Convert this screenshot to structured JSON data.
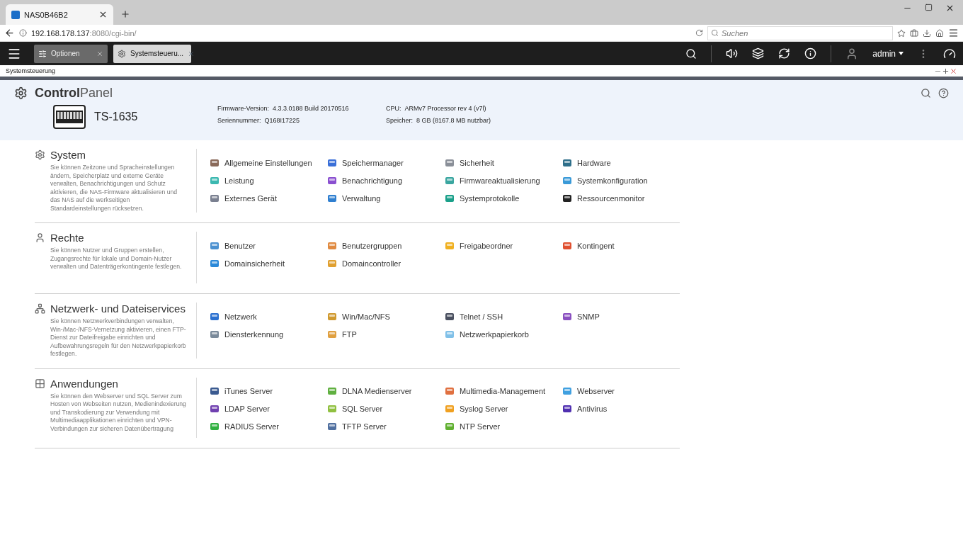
{
  "browser": {
    "tab": {
      "title": "NAS0B46B2"
    },
    "url": {
      "host": "192.168.178.137",
      "rest": ":8080/cgi-bin/"
    },
    "search": {
      "placeholder": "Suchen"
    }
  },
  "qts_bar": {
    "tabs": [
      {
        "label": "Optionen",
        "selected": false
      },
      {
        "label": "Systemsteueru...",
        "selected": true
      }
    ],
    "user": "admin"
  },
  "window": {
    "title": "Systemsteuerung"
  },
  "header": {
    "title_bold": "Control",
    "title_light": "Panel",
    "model": "TS-1635",
    "info": [
      {
        "label": "Firmware-Version:",
        "value": "4.3.3.0188 Build 20170516"
      },
      {
        "label": "Seriennummer:",
        "value": "Q168I17225"
      },
      {
        "label": "CPU:",
        "value": "ARMv7 Processor rev 4 (v7l)"
      },
      {
        "label": "Speicher:",
        "value": "8 GB (8167.8 MB nutzbar)"
      }
    ]
  },
  "sections": [
    {
      "title": "System",
      "description": "Sie können Zeitzone und Spracheinstellungen ändern, Speicherplatz und externe Geräte verwalten, Benachrichtigungen und Schutz aktivieren, die NAS-Firmware aktualisieren und das NAS auf die werkseitigen Standardeinstellungen rücksetzen.",
      "items": [
        {
          "label": "Allgemeine Einstellungen",
          "color": "#8a6a5a"
        },
        {
          "label": "Speichermanager",
          "color": "#3a6fd8"
        },
        {
          "label": "Sicherheit",
          "color": "#8a8f98"
        },
        {
          "label": "Hardware",
          "color": "#2f6f8a"
        },
        {
          "label": "Leistung",
          "color": "#3bb8b0"
        },
        {
          "label": "Benachrichtigung",
          "color": "#8a4fd0"
        },
        {
          "label": "Firmwareaktualisierung",
          "color": "#3aa6a0"
        },
        {
          "label": "Systemkonfiguration",
          "color": "#3a9ad8"
        },
        {
          "label": "Externes Gerät",
          "color": "#7a8090"
        },
        {
          "label": "Verwaltung",
          "color": "#2f7fd0"
        },
        {
          "label": "Systemprotokolle",
          "color": "#1aa08a"
        },
        {
          "label": "Ressourcenmonitor",
          "color": "#222222"
        }
      ]
    },
    {
      "title": "Rechte",
      "description": "Sie können Nutzer und Gruppen erstellen, Zugangsrechte für lokale und Domain-Nutzer verwalten und Datenträgerkontingente festlegen.",
      "items": [
        {
          "label": "Benutzer",
          "color": "#4a90d0"
        },
        {
          "label": "Benutzergruppen",
          "color": "#e08a40"
        },
        {
          "label": "Freigabeordner",
          "color": "#f0b020"
        },
        {
          "label": "Kontingent",
          "color": "#e05030"
        },
        {
          "label": "Domainsicherheit",
          "color": "#2a88d8"
        },
        {
          "label": "Domaincontroller",
          "color": "#e0a030"
        }
      ]
    },
    {
      "title": "Netzwerk- und Dateiservices",
      "description": "Sie können Netzwerkverbindungen verwalten, Win-/Mac-/NFS-Vernetzung aktivieren, einen FTP-Dienst zur Dateifreigabe einrichten und Aufbewahrungsregeln für den Netzwerkpapierkorb festlegen.",
      "items": [
        {
          "label": "Netzwerk",
          "color": "#2a70d0"
        },
        {
          "label": "Win/Mac/NFS",
          "color": "#d09a30"
        },
        {
          "label": "Telnet / SSH",
          "color": "#4a5060"
        },
        {
          "label": "SNMP",
          "color": "#8a50c0"
        },
        {
          "label": "Diensterkennung",
          "color": "#7a8a9a"
        },
        {
          "label": "FTP",
          "color": "#e0a040"
        },
        {
          "label": "Netzwerkpapierkorb",
          "color": "#80c0e8"
        }
      ]
    },
    {
      "title": "Anwendungen",
      "description": "Sie können den Webserver und SQL Server zum Hosten von Webseiten nutzen, Medienindexierung und Transkodierung zur Verwendung mit Multimediaapplikationen einrichten und VPN-Verbindungen zur sicheren Datenübertragung",
      "items": [
        {
          "label": "iTunes Server",
          "color": "#3a5a90"
        },
        {
          "label": "DLNA Medienserver",
          "color": "#60b040"
        },
        {
          "label": "Multimedia-Management",
          "color": "#e07040"
        },
        {
          "label": "Webserver",
          "color": "#40a0e0"
        },
        {
          "label": "LDAP Server",
          "color": "#7040b0"
        },
        {
          "label": "SQL Server",
          "color": "#90c040"
        },
        {
          "label": "Syslog Server",
          "color": "#f0a020"
        },
        {
          "label": "Antivirus",
          "color": "#5030b0"
        },
        {
          "label": "RADIUS Server",
          "color": "#30b040"
        },
        {
          "label": "TFTP Server",
          "color": "#5070a0"
        },
        {
          "label": "NTP Server",
          "color": "#60b030"
        }
      ]
    }
  ]
}
